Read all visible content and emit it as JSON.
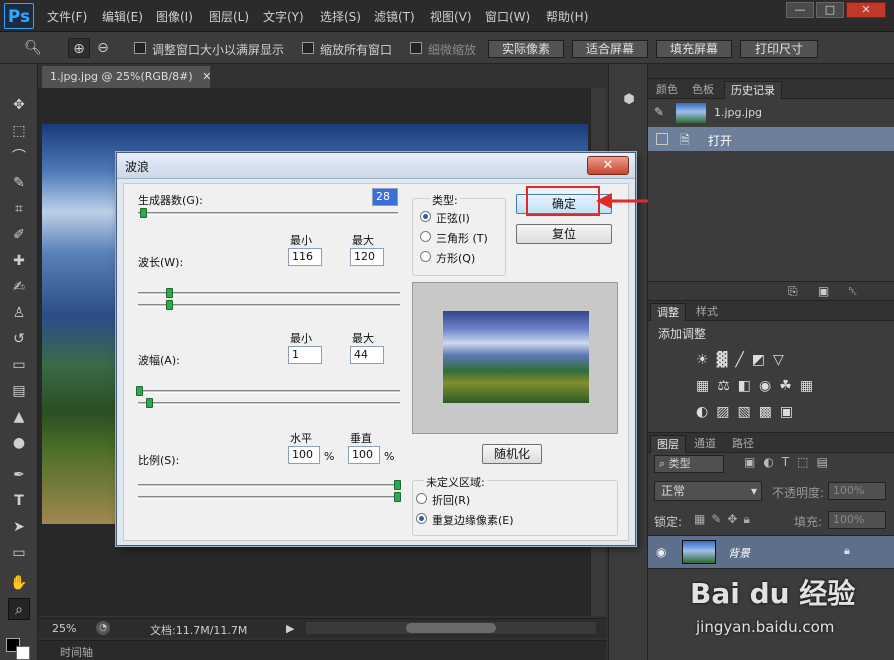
{
  "app": {
    "logo": "Ps"
  },
  "menu": [
    "文件(F)",
    "编辑(E)",
    "图像(I)",
    "图层(L)",
    "文字(Y)",
    "选择(S)",
    "滤镜(T)",
    "视图(V)",
    "窗口(W)",
    "帮助(H)"
  ],
  "window_controls": {
    "minimize": "—",
    "maximize": "□",
    "close": "✕"
  },
  "options": {
    "resize_window": "调整窗口大小以满屏显示",
    "zoom_all": "缩放所有窗口",
    "scrubby": "细微缩放",
    "actual_pixels": "实际像素",
    "fit_screen": "适合屏幕",
    "fill_screen": "填充屏幕",
    "print_size": "打印尺寸"
  },
  "document": {
    "tab_title": "1.jpg.jpg @ 25%(RGB/8#)",
    "zoom": "25%",
    "doc_info": "文档:11.7M/11.7M",
    "timeline": "时间轴"
  },
  "history_panel": {
    "tabs": [
      "颜色",
      "色板",
      "历史记录"
    ],
    "snapshot": "1.jpg.jpg",
    "step": "打开"
  },
  "adjust_panel": {
    "tabs": [
      "调整",
      "样式"
    ],
    "title": "添加调整"
  },
  "layers_panel": {
    "tabs": [
      "图层",
      "通道",
      "路径"
    ],
    "filter_kind": "类型",
    "blend_mode": "正常",
    "opacity_label": "不透明度:",
    "opacity_value": "100%",
    "lock_label": "锁定:",
    "fill_label": "填充:",
    "fill_value": "100%",
    "layer_name": "背景"
  },
  "dialog": {
    "title": "波浪",
    "generators_label": "生成器数(G):",
    "generators_value": "28",
    "min_label": "最小",
    "max_label": "最大",
    "wavelength_label": "波长(W):",
    "wavelength_min": "116",
    "wavelength_max": "120",
    "amplitude_label": "波幅(A):",
    "amplitude_min": "1",
    "amplitude_max": "44",
    "scale_label": "比例(S):",
    "horizontal_label": "水平",
    "vertical_label": "垂直",
    "scale_h": "100",
    "scale_v": "100",
    "percent": "%",
    "type_label": "类型:",
    "type_sine": "正弦(I)",
    "type_triangle": "三角形 (T)",
    "type_square": "方形(Q)",
    "ok": "确定",
    "reset": "复位",
    "randomize": "随机化",
    "undefined_label": "未定义区域:",
    "wrap_around": "折回(R)",
    "repeat_edge": "重复边缘像素(E)"
  },
  "watermark": {
    "brand": "Bai du 经验",
    "url": "jingyan.baidu.com"
  },
  "colors": {
    "accent": "#31a8ff",
    "highlight": "#e02a2a",
    "panel": "#3c3c3c"
  }
}
